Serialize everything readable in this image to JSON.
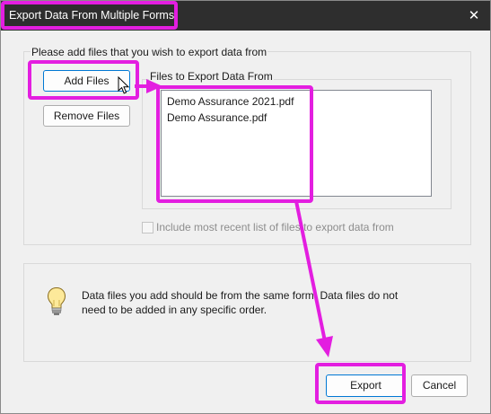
{
  "window": {
    "title": "Export Data From Multiple Forms",
    "close_glyph": "✕"
  },
  "main_group": {
    "caption": "Please add files that you wish to export data from"
  },
  "buttons": {
    "add_files": "Add Files",
    "remove_files": "Remove Files",
    "export": "Export",
    "cancel": "Cancel"
  },
  "files": {
    "caption": "Files to Export Data From",
    "items": [
      "Demo Assurance 2021.pdf",
      "Demo Assurance.pdf"
    ]
  },
  "options": {
    "include_recent_label": "Include most recent list of files to export data from",
    "include_recent_checked": false
  },
  "info": {
    "icon": "lightbulb-icon",
    "text": "Data files you add should be from the same form. Data files do not need to be added in any specific order."
  },
  "annotation": {
    "color": "#e31ee0"
  },
  "colors": {
    "titlebar": "#2e2e2e",
    "dialog_bg": "#f0f0f0",
    "default_button_border": "#0078d4"
  }
}
